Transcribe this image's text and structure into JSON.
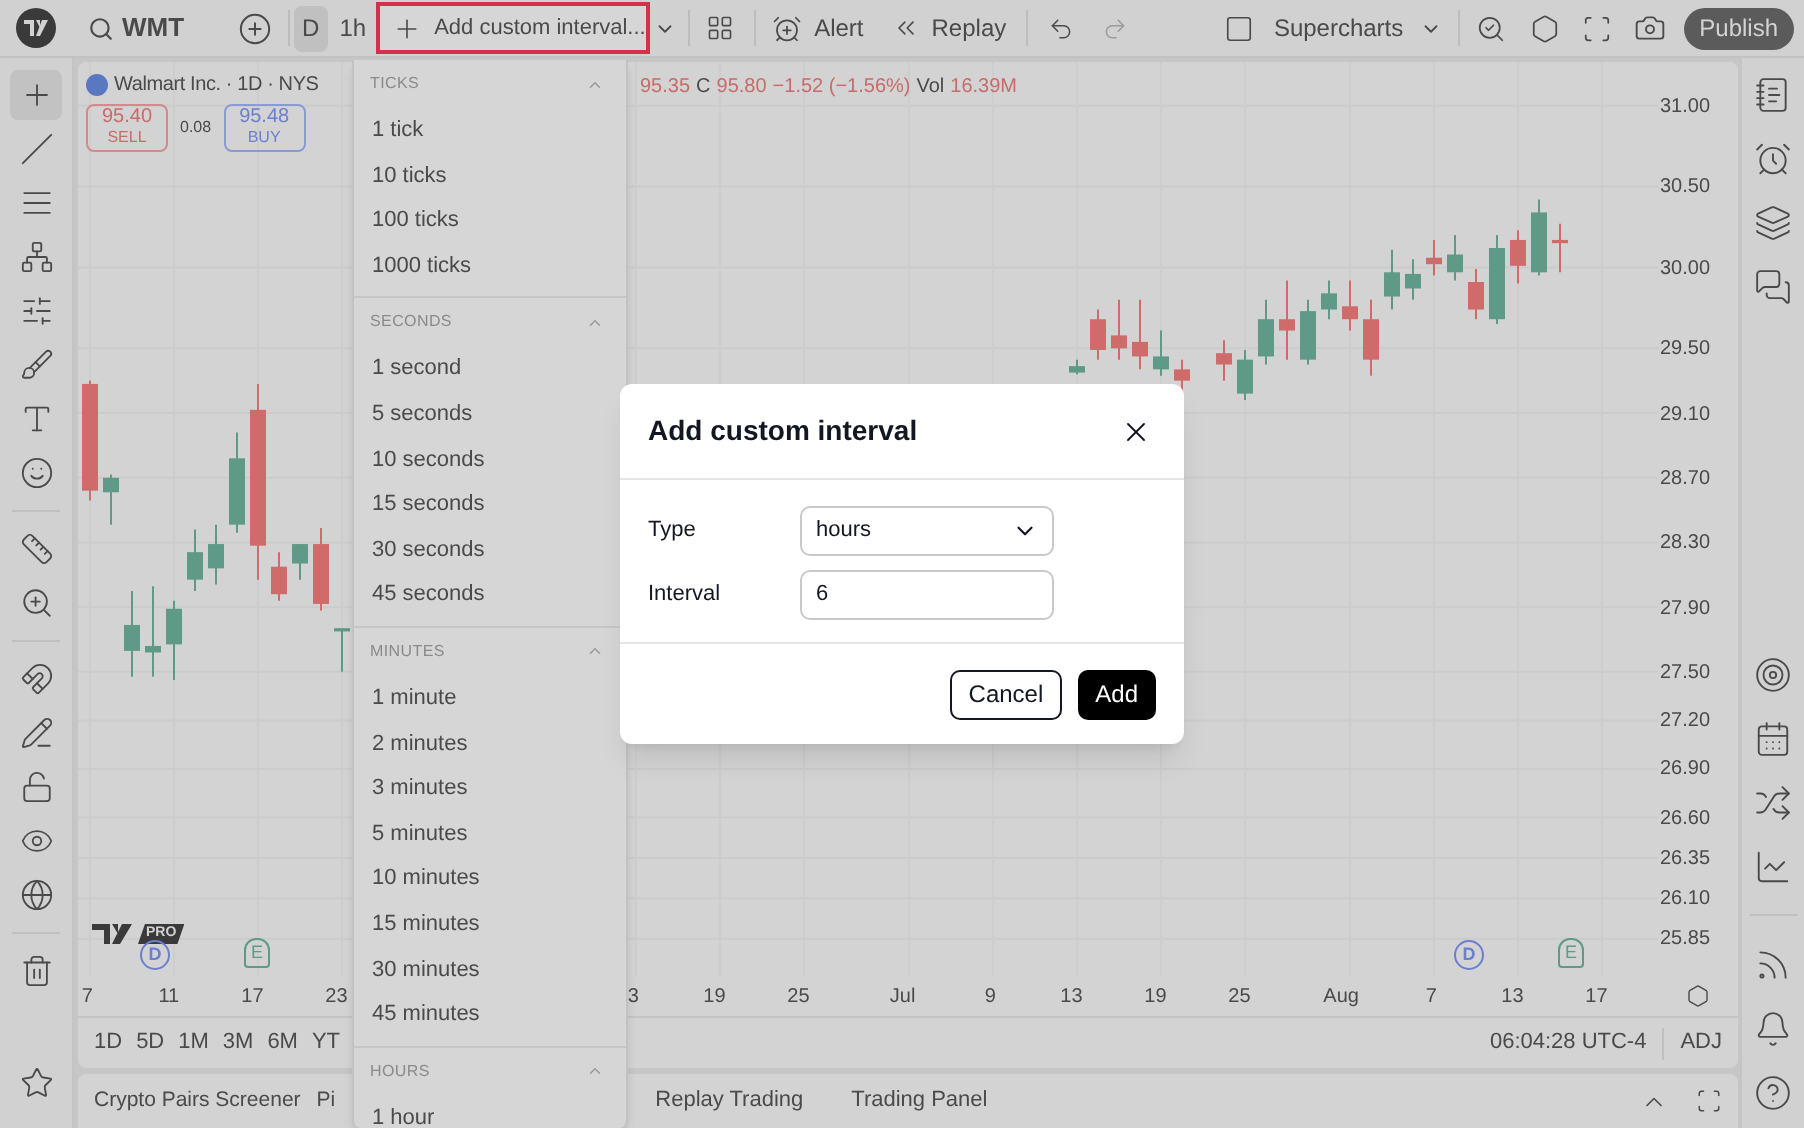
{
  "toolbar": {
    "symbol": "WMT",
    "intervals": [
      {
        "label": "D",
        "selected": true
      },
      {
        "label": "1h",
        "selected": false
      }
    ],
    "custom_interval_button": "Add custom interval...",
    "alert": "Alert",
    "replay": "Replay",
    "layout_name": "Supercharts",
    "publish": "Publish"
  },
  "left_tools": [
    {
      "selected": true
    },
    {
      "selected": false
    },
    {
      "selected": false
    },
    {
      "selected": false
    },
    {
      "selected": false
    },
    {
      "selected": false
    },
    {
      "selected": false
    },
    {
      "selected": false
    },
    {
      "selected": false
    },
    {
      "selected": false
    },
    {
      "selected": false
    },
    {
      "selected": false
    },
    {
      "selected": false
    },
    {
      "selected": false
    },
    {
      "selected": false
    },
    {
      "selected": false
    },
    {
      "selected": false
    }
  ],
  "legend": {
    "title": "Walmart Inc. · 1D · NYS",
    "low": "95.35",
    "close_label": "C",
    "close": "95.80",
    "change": "−1.52 (−1.56%)",
    "volume_label": "Vol",
    "volume": "16.39M",
    "sell_price": "95.40",
    "sell_label": "SELL",
    "spread": "0.08",
    "buy_price": "95.48",
    "buy_label": "BUY"
  },
  "chart_logo": {
    "badge": "PRO"
  },
  "events": [
    {
      "kind": "dividend",
      "label": "D"
    },
    {
      "kind": "earnings",
      "label": "E"
    },
    {
      "kind": "dividend",
      "label": "D"
    },
    {
      "kind": "earnings",
      "label": "E"
    }
  ],
  "chart_data": {
    "type": "candlestick",
    "categories": [
      "7",
      null,
      null,
      null,
      "11",
      null,
      null,
      null,
      "17",
      null,
      null,
      null,
      "23",
      null,
      null,
      null,
      null,
      null,
      null,
      null,
      null,
      null,
      null,
      null,
      null,
      null,
      "3",
      null,
      null,
      null,
      "19",
      null,
      null,
      null,
      "25",
      null,
      null,
      null,
      null,
      "Jul",
      null,
      null,
      null,
      "9",
      null,
      null,
      null,
      "13",
      null,
      null,
      null,
      "19",
      null,
      null,
      null,
      "25",
      null,
      null,
      null,
      null,
      "Aug",
      null,
      null,
      null,
      "7",
      null,
      null,
      null,
      "13",
      null,
      null,
      null,
      "17",
      null,
      null
    ],
    "ohlc": [
      [
        29.28,
        29.3,
        28.56,
        28.62
      ],
      [
        28.61,
        28.72,
        28.41,
        28.7
      ],
      [
        27.63,
        28.0,
        27.47,
        27.79
      ],
      [
        27.62,
        28.03,
        27.47,
        27.66
      ],
      [
        27.67,
        27.94,
        27.45,
        27.89
      ],
      [
        28.07,
        28.38,
        28.0,
        28.24
      ],
      [
        28.14,
        28.41,
        28.04,
        28.29
      ],
      [
        28.41,
        28.98,
        28.36,
        28.82
      ],
      [
        29.12,
        29.28,
        28.07,
        28.28
      ],
      [
        28.15,
        28.24,
        27.94,
        27.98
      ],
      [
        28.17,
        28.29,
        28.07,
        28.29
      ],
      [
        28.29,
        28.39,
        27.88,
        27.92
      ],
      [
        27.75,
        27.77,
        27.5,
        27.77
      ],
      null,
      null,
      null,
      null,
      null,
      null,
      null,
      null,
      null,
      null,
      null,
      null,
      null,
      null,
      null,
      null,
      null,
      null,
      null,
      null,
      null,
      null,
      null,
      null,
      null,
      null,
      null,
      null,
      null,
      null,
      null,
      null,
      null,
      null,
      [
        29.35,
        29.43,
        29.34,
        29.39
      ],
      [
        29.68,
        29.74,
        29.43,
        29.49
      ],
      [
        29.58,
        29.8,
        29.43,
        29.5
      ],
      [
        29.54,
        29.8,
        29.37,
        29.45
      ],
      [
        29.37,
        29.61,
        29.33,
        29.45
      ],
      [
        29.37,
        29.43,
        29.23,
        29.3
      ],
      null,
      [
        29.47,
        29.55,
        29.3,
        29.4
      ],
      [
        29.22,
        29.49,
        29.18,
        29.43
      ],
      [
        29.45,
        29.8,
        29.4,
        29.68
      ],
      [
        29.68,
        29.92,
        29.43,
        29.61
      ],
      [
        29.43,
        29.8,
        29.4,
        29.73
      ],
      [
        29.74,
        29.92,
        29.68,
        29.84
      ],
      [
        29.76,
        29.92,
        29.61,
        29.68
      ],
      [
        29.68,
        29.8,
        29.33,
        29.43
      ],
      [
        29.82,
        30.11,
        29.74,
        29.97
      ],
      [
        29.87,
        30.05,
        29.8,
        29.96
      ],
      [
        30.06,
        30.17,
        29.95,
        30.02
      ],
      [
        29.97,
        30.2,
        29.92,
        30.08
      ],
      [
        29.91,
        29.99,
        29.68,
        29.74
      ],
      [
        29.68,
        30.2,
        29.65,
        30.12
      ],
      [
        30.17,
        30.23,
        29.9,
        30.01
      ],
      [
        29.97,
        30.42,
        29.95,
        30.34
      ],
      [
        30.17,
        30.27,
        29.97,
        30.15
      ],
      null,
      null,
      null,
      null
    ],
    "grid": true,
    "ylim": [
      25.62,
      31.27
    ],
    "yticks": [
      {
        "value": 31.0,
        "label": "31.00"
      },
      {
        "value": 30.5,
        "label": "30.50"
      },
      {
        "value": 30.0,
        "label": "30.00"
      },
      {
        "value": 29.5,
        "label": "29.50"
      },
      {
        "value": 29.1,
        "label": "29.10"
      },
      {
        "value": 28.7,
        "label": "28.70"
      },
      {
        "value": 28.3,
        "label": "28.30"
      },
      {
        "value": 27.9,
        "label": "27.90"
      },
      {
        "value": 27.5,
        "label": "27.50"
      },
      {
        "value": 27.2,
        "label": "27.20"
      },
      {
        "value": 26.9,
        "label": "26.90"
      },
      {
        "value": 26.6,
        "label": "26.60"
      },
      {
        "value": 26.35,
        "label": "26.35"
      },
      {
        "value": 26.1,
        "label": "26.10"
      },
      {
        "value": 25.85,
        "label": "25.85"
      }
    ]
  },
  "ranges": [
    "1D",
    "5D",
    "1M",
    "3M",
    "6M",
    "YT"
  ],
  "clock": "06:04:28 UTC-4",
  "adjust": "ADJ",
  "bottom_tabs_left": [
    "Crypto Pairs Screener",
    "Pi"
  ],
  "bottom_tabs_right": [
    "Replay Trading",
    "Trading Panel"
  ],
  "interval_menu": {
    "sections": [
      {
        "title": "TICKS",
        "expanded": true,
        "items": [
          "1 tick",
          "10 ticks",
          "100 ticks",
          "1000 ticks"
        ]
      },
      {
        "title": "SECONDS",
        "expanded": true,
        "items": [
          "1 second",
          "5 seconds",
          "10 seconds",
          "15 seconds",
          "30 seconds",
          "45 seconds"
        ]
      },
      {
        "title": "MINUTES",
        "expanded": true,
        "items": [
          "1 minute",
          "2 minutes",
          "3 minutes",
          "5 minutes",
          "10 minutes",
          "15 minutes",
          "30 minutes",
          "45 minutes"
        ]
      },
      {
        "title": "HOURS",
        "expanded": true,
        "items": [
          "1 hour"
        ]
      }
    ]
  },
  "dialog": {
    "title": "Add custom interval",
    "fields": [
      {
        "label": "Type",
        "kind": "select",
        "value": "hours"
      },
      {
        "label": "Interval",
        "kind": "input",
        "value": "6"
      }
    ],
    "buttons": [
      {
        "label": "Cancel",
        "kind": "secondary"
      },
      {
        "label": "Add",
        "kind": "primary"
      }
    ]
  }
}
